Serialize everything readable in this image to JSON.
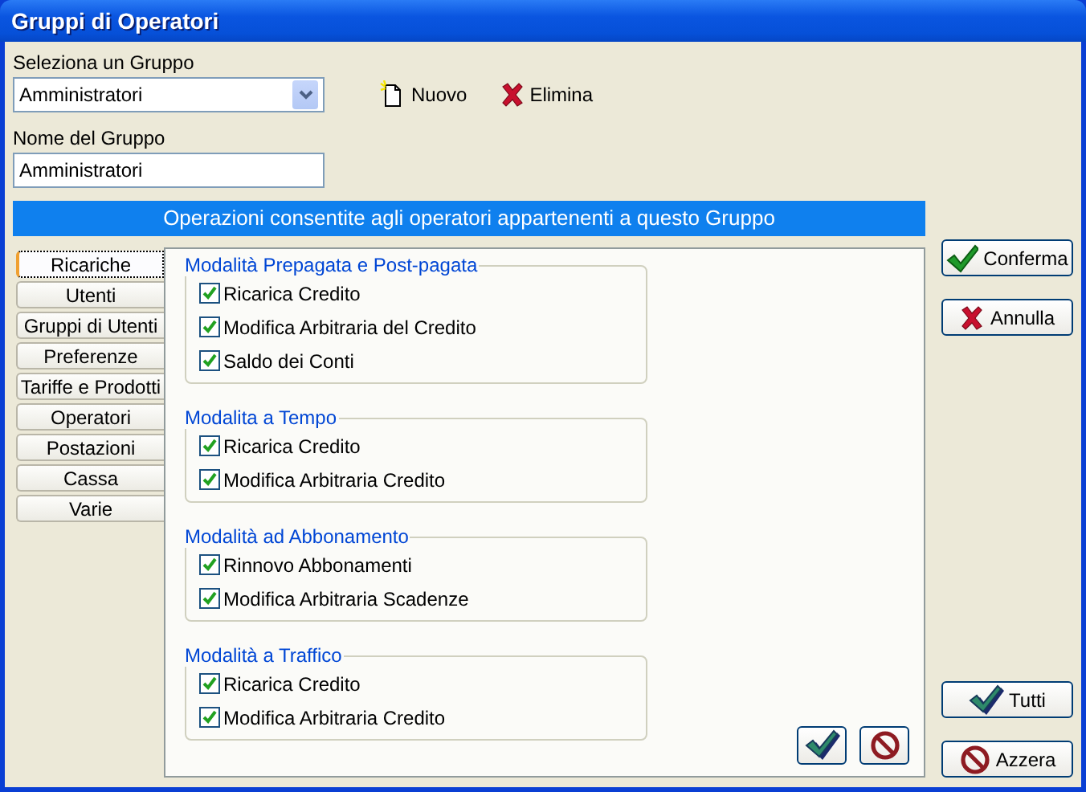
{
  "window": {
    "title": "Gruppi di Operatori"
  },
  "group_select": {
    "label": "Seleziona un Gruppo",
    "value": "Amministratori"
  },
  "toolbar": [
    {
      "kind": "new",
      "label": "Nuovo"
    },
    {
      "kind": "delete",
      "label": "Elimina"
    }
  ],
  "group_name": {
    "label": "Nome del Gruppo",
    "value": "Amministratori"
  },
  "banner": "Operazioni consentite agli operatori appartenenti a questo Gruppo",
  "tabs": [
    {
      "label": "Ricariche",
      "selected": true
    },
    {
      "label": "Utenti",
      "selected": false
    },
    {
      "label": "Gruppi di Utenti",
      "selected": false
    },
    {
      "label": "Preferenze",
      "selected": false
    },
    {
      "label": "Tariffe e Prodotti",
      "selected": false
    },
    {
      "label": "Operatori",
      "selected": false
    },
    {
      "label": "Postazioni",
      "selected": false
    },
    {
      "label": "Cassa",
      "selected": false
    },
    {
      "label": "Varie",
      "selected": false
    }
  ],
  "sections": [
    {
      "title": "Modalità Prepagata e Post-pagata",
      "options": [
        {
          "label": "Ricarica Credito",
          "checked": true
        },
        {
          "label": "Modifica Arbitraria del Credito",
          "checked": true
        },
        {
          "label": "Saldo dei Conti",
          "checked": true
        }
      ]
    },
    {
      "title": "Modalita a Tempo",
      "options": [
        {
          "label": "Ricarica Credito",
          "checked": true
        },
        {
          "label": "Modifica Arbitraria Credito",
          "checked": true
        }
      ]
    },
    {
      "title": "Modalità ad Abbonamento",
      "options": [
        {
          "label": "Rinnovo Abbonamenti",
          "checked": true
        },
        {
          "label": "Modifica Arbitraria Scadenze",
          "checked": true
        }
      ]
    },
    {
      "title": "Modalità a Traffico",
      "options": [
        {
          "label": "Ricarica Credito",
          "checked": true
        },
        {
          "label": "Modifica Arbitraria Credito",
          "checked": true
        }
      ]
    }
  ],
  "panel_buttons": [
    {
      "kind": "check-all"
    },
    {
      "kind": "clear"
    }
  ],
  "top_buttons": [
    {
      "kind": "confirm",
      "label": "Conferma"
    },
    {
      "kind": "cancel",
      "label": "Annulla"
    }
  ],
  "bottom_buttons": [
    {
      "kind": "check-all",
      "label": "Tutti"
    },
    {
      "kind": "clear",
      "label": "Azzera"
    }
  ]
}
